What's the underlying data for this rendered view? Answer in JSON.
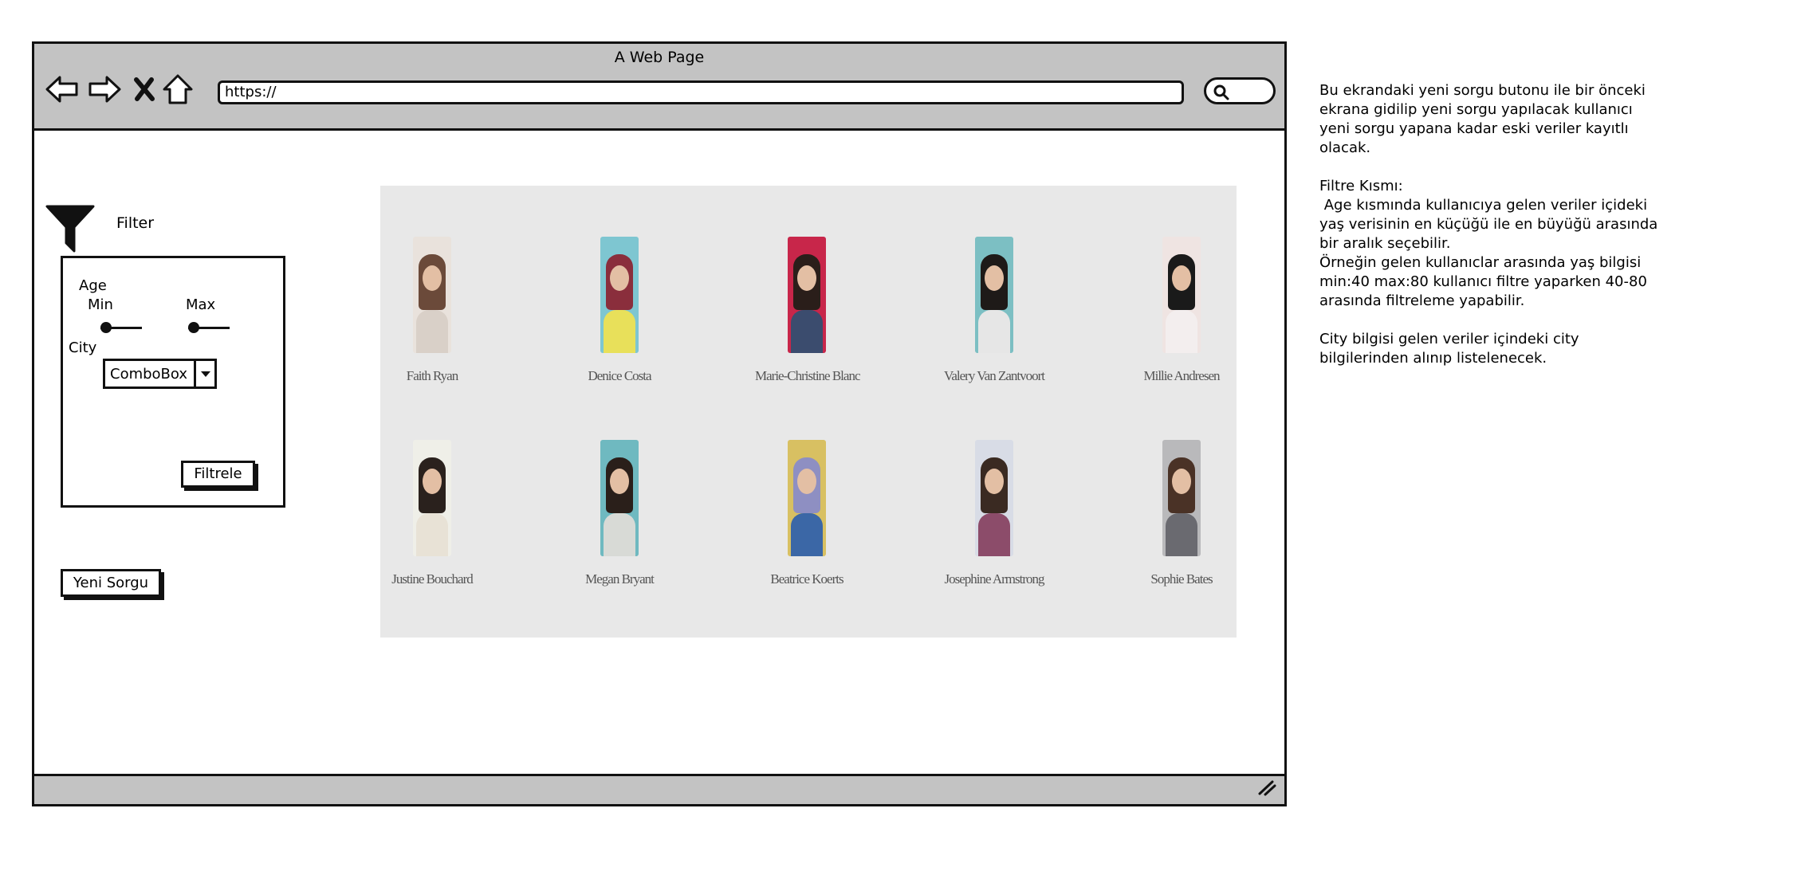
{
  "window": {
    "title": "A Web Page",
    "url": "https://"
  },
  "icons": {
    "back": "back-arrow-icon",
    "forward": "forward-arrow-icon",
    "close": "close-x-icon",
    "home": "home-icon",
    "search": "search-icon",
    "filter": "funnel-icon",
    "dropdown": "chevron-down-icon",
    "resize": "resize-grip-icon"
  },
  "filter": {
    "title": "Filter",
    "age_label": "Age",
    "min_label": "Min",
    "max_label": "Max",
    "city_label": "City",
    "city_value": "ComboBox",
    "apply_label": "Filtrele"
  },
  "new_query_label": "Yeni Sorgu",
  "people": [
    {
      "name": "Faith Ryan",
      "hair": "#6b4a3a",
      "bg": "#e9e2dc",
      "top": "#d9d0c8"
    },
    {
      "name": "Denice Costa",
      "hair": "#8a2e3c",
      "bg": "#7ec6d1",
      "top": "#e8e05a"
    },
    {
      "name": "Marie-Christine Blanc",
      "hair": "#2a1e1a",
      "bg": "#c8264a",
      "top": "#3b4c6e"
    },
    {
      "name": "Valery Van Zantvoort",
      "hair": "#1e1a18",
      "bg": "#7cbfc3",
      "top": "#e6e6e6"
    },
    {
      "name": "Millie Andresen",
      "hair": "#1a1a1a",
      "bg": "#efe4e2",
      "top": "#f3eeee"
    },
    {
      "name": "Justine Bouchard",
      "hair": "#2a211d",
      "bg": "#efefe8",
      "top": "#e8e2d6"
    },
    {
      "name": "Megan Bryant",
      "hair": "#2a1f1a",
      "bg": "#6fb9c0",
      "top": "#d8dad6"
    },
    {
      "name": "Beatrice Koerts",
      "hair": "#8e8fc2",
      "bg": "#d8c062",
      "top": "#3b67a6"
    },
    {
      "name": "Josephine Armstrong",
      "hair": "#3a2a22",
      "bg": "#d8dce6",
      "top": "#8c4c6a"
    },
    {
      "name": "Sophie Bates",
      "hair": "#4a3226",
      "bg": "#b9b9bb",
      "top": "#6a6a70"
    }
  ],
  "annotation": "Bu ekrandaki yeni sorgu butonu ile bir önceki\nekrana gidilip yeni sorgu yapılacak kullanıcı\nyeni sorgu yapana kadar eski veriler kayıtlı\nolacak.\n\nFiltre Kısmı:\n Age kısmında kullanıcıya gelen veriler içideki\nyaş verisinin en küçüğü ile en büyüğü arasında\nbir aralık seçebilir.\nÖrneğin gelen kullanıclar arasında yaş bilgisi\nmin:40 max:80 kullanıcı filtre yaparken 40-80\narasında filtreleme yapabilir.\n\nCity bilgisi gelen veriler içindeki city\nbilgilerinden alınıp listelenecek."
}
